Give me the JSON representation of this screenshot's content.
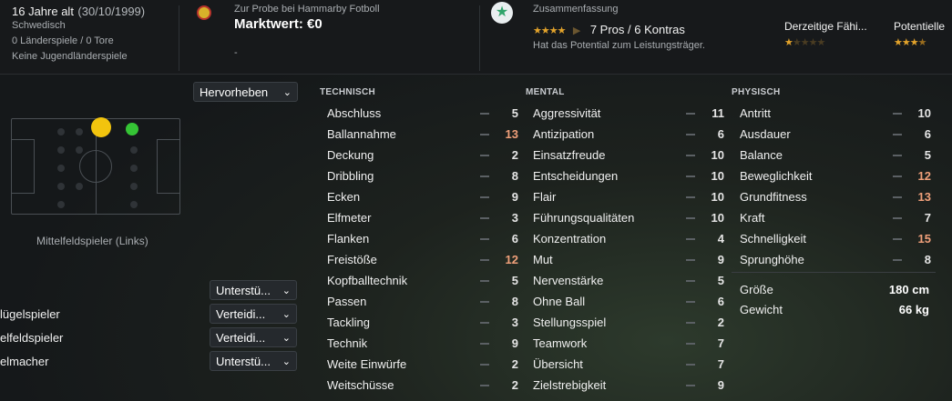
{
  "player": {
    "age": "16 Jahre alt",
    "dob": "(30/10/1999)",
    "nationality": "Schwedisch",
    "caps": "0 Länderspiele / 0 Tore",
    "youth_caps": "Keine Jugendländerspiele"
  },
  "club": {
    "status": "Zur Probe bei Hammarby Fotboll",
    "market_value": "Marktwert: €0",
    "extra": "-"
  },
  "summary": {
    "title": "Zusammenfassung",
    "pros_cons": "7 Pros / 6 Kontras",
    "potential_text": "Hat das Potential zum Leistungsträger.",
    "rating_stars": 3.5
  },
  "ability": {
    "current_label": "Derzeitige Fähi...",
    "potential_label": "Potentielle",
    "current_stars": 0.5,
    "potential_stars": 3.5
  },
  "highlight": {
    "label": "Hervorheben"
  },
  "position": {
    "label": "Mittelfeldspieler (Links)"
  },
  "roles": [
    {
      "name": "",
      "duty": "Unterstü..."
    },
    {
      "name": "lügelspieler",
      "duty": "Verteidi..."
    },
    {
      "name": "elfeldspieler",
      "duty": "Verteidi..."
    },
    {
      "name": "elmacher",
      "duty": "Unterstü..."
    }
  ],
  "sections": {
    "technical": "TECHNISCH",
    "mental": "MENTAL",
    "physical": "PHYSISCH"
  },
  "technical": [
    {
      "name": "Abschluss",
      "value": "5",
      "tone": "norm"
    },
    {
      "name": "Ballannahme",
      "value": "13",
      "tone": "good"
    },
    {
      "name": "Deckung",
      "value": "2",
      "tone": "norm"
    },
    {
      "name": "Dribbling",
      "value": "8",
      "tone": "norm"
    },
    {
      "name": "Ecken",
      "value": "9",
      "tone": "norm"
    },
    {
      "name": "Elfmeter",
      "value": "3",
      "tone": "norm"
    },
    {
      "name": "Flanken",
      "value": "6",
      "tone": "norm"
    },
    {
      "name": "Freistöße",
      "value": "12",
      "tone": "good"
    },
    {
      "name": "Kopfballtechnik",
      "value": "5",
      "tone": "norm"
    },
    {
      "name": "Passen",
      "value": "8",
      "tone": "norm"
    },
    {
      "name": "Tackling",
      "value": "3",
      "tone": "norm"
    },
    {
      "name": "Technik",
      "value": "9",
      "tone": "norm"
    },
    {
      "name": "Weite Einwürfe",
      "value": "2",
      "tone": "norm"
    },
    {
      "name": "Weitschüsse",
      "value": "2",
      "tone": "norm"
    }
  ],
  "mental": [
    {
      "name": "Aggressivität",
      "value": "11",
      "tone": "norm"
    },
    {
      "name": "Antizipation",
      "value": "6",
      "tone": "norm"
    },
    {
      "name": "Einsatzfreude",
      "value": "10",
      "tone": "norm"
    },
    {
      "name": "Entscheidungen",
      "value": "10",
      "tone": "norm"
    },
    {
      "name": "Flair",
      "value": "10",
      "tone": "norm"
    },
    {
      "name": "Führungsqualitäten",
      "value": "10",
      "tone": "norm"
    },
    {
      "name": "Konzentration",
      "value": "4",
      "tone": "norm"
    },
    {
      "name": "Mut",
      "value": "9",
      "tone": "norm"
    },
    {
      "name": "Nervenstärke",
      "value": "5",
      "tone": "norm"
    },
    {
      "name": "Ohne Ball",
      "value": "6",
      "tone": "norm"
    },
    {
      "name": "Stellungsspiel",
      "value": "2",
      "tone": "norm"
    },
    {
      "name": "Teamwork",
      "value": "7",
      "tone": "norm"
    },
    {
      "name": "Übersicht",
      "value": "7",
      "tone": "norm"
    },
    {
      "name": "Zielstrebigkeit",
      "value": "9",
      "tone": "norm"
    }
  ],
  "physical": [
    {
      "name": "Antritt",
      "value": "10",
      "tone": "norm"
    },
    {
      "name": "Ausdauer",
      "value": "6",
      "tone": "norm"
    },
    {
      "name": "Balance",
      "value": "5",
      "tone": "norm"
    },
    {
      "name": "Beweglichkeit",
      "value": "12",
      "tone": "good"
    },
    {
      "name": "Grundfitness",
      "value": "13",
      "tone": "good"
    },
    {
      "name": "Kraft",
      "value": "7",
      "tone": "norm"
    },
    {
      "name": "Schnelligkeit",
      "value": "15",
      "tone": "good"
    },
    {
      "name": "Sprunghöhe",
      "value": "8",
      "tone": "norm"
    }
  ],
  "body": {
    "height_label": "Größe",
    "height": "180 cm",
    "weight_label": "Gewicht",
    "weight": "66 kg"
  },
  "colors": {
    "good_value": "#f0a07a",
    "star": "#e3a32b",
    "position_primary": "#f2c40e",
    "position_secondary": "#35c435"
  }
}
